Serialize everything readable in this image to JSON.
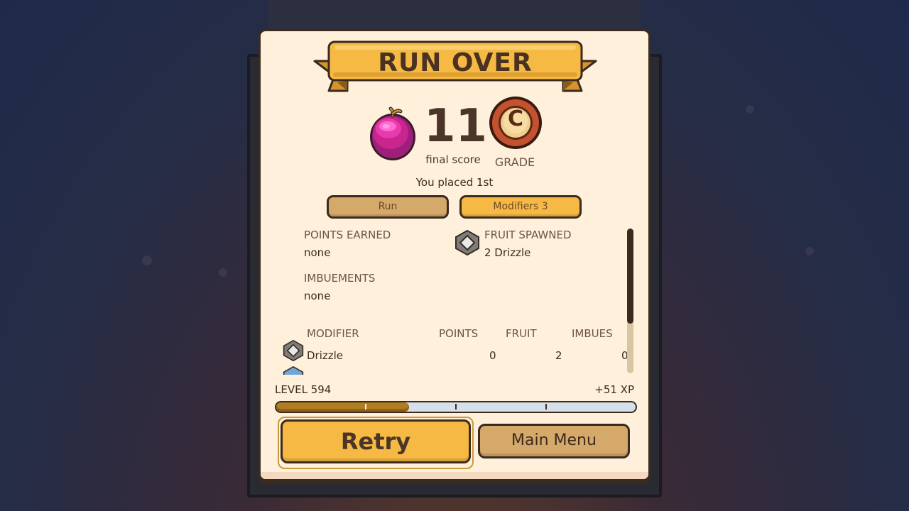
{
  "title": "RUN OVER",
  "score": {
    "value": "11",
    "label": "final score"
  },
  "grade": {
    "letter": "C",
    "label": "GRADE"
  },
  "placement": "You placed 1st",
  "tabs": {
    "run": "Run",
    "modifiers": "Modifiers  3"
  },
  "summary": {
    "points_earned": {
      "title": "POINTS EARNED",
      "value": "none"
    },
    "imbuements": {
      "title": "IMBUEMENTS",
      "value": "none"
    },
    "fruit_spawned": {
      "title": "FRUIT SPAWNED",
      "value": "2 Drizzle"
    }
  },
  "table": {
    "headers": {
      "modifier": "MODIFIER",
      "points": "POINTS",
      "fruit": "FRUIT",
      "imbues": "IMBUES"
    },
    "rows": [
      {
        "modifier": "Drizzle",
        "points": "0",
        "fruit": "2",
        "imbues": "0"
      }
    ]
  },
  "progress": {
    "level": "LEVEL 594",
    "xp_gain": "+51 XP",
    "fill_fraction": 0.37
  },
  "buttons": {
    "retry": "Retry",
    "main_menu": "Main Menu"
  },
  "colors": {
    "panel": "#fff0dc",
    "accent": "#f5b944",
    "tan": "#d4a96a",
    "outline": "#3b2a1e",
    "xp_fill": "#b07d23"
  }
}
